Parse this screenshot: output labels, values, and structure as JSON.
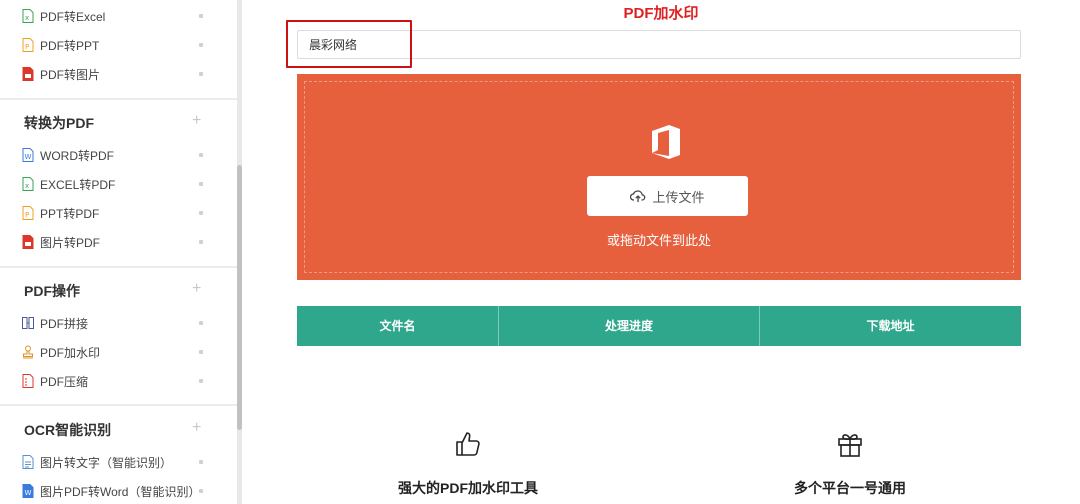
{
  "sidebar": {
    "groups": [
      {
        "title": "",
        "items": [
          {
            "label": "PDF转Excel",
            "icon": "excel-file-icon"
          },
          {
            "label": "PDF转PPT",
            "icon": "ppt-file-icon"
          },
          {
            "label": "PDF转图片",
            "icon": "image-file-icon"
          }
        ]
      },
      {
        "title": "转换为PDF",
        "items": [
          {
            "label": "WORD转PDF",
            "icon": "word-file-icon"
          },
          {
            "label": "EXCEL转PDF",
            "icon": "excel-file-icon"
          },
          {
            "label": "PPT转PDF",
            "icon": "ppt-file-icon"
          },
          {
            "label": "图片转PDF",
            "icon": "image-file-icon"
          }
        ]
      },
      {
        "title": "PDF操作",
        "items": [
          {
            "label": "PDF拼接",
            "icon": "merge-icon"
          },
          {
            "label": "PDF加水印",
            "icon": "stamp-icon"
          },
          {
            "label": "PDF压缩",
            "icon": "compress-file-icon"
          }
        ]
      },
      {
        "title": "OCR智能识别",
        "items": [
          {
            "label": "图片转文字（智能识别）",
            "icon": "image-text-icon"
          },
          {
            "label": "图片PDF转Word（智能识别）",
            "icon": "word-file-icon"
          }
        ]
      }
    ],
    "expand_symbol": "+"
  },
  "main": {
    "title": "PDF加水印",
    "watermark_input": {
      "value": "晨彩网络",
      "placeholder": ""
    },
    "upload": {
      "icon": "office-icon",
      "button_label": "上传文件",
      "button_icon": "cloud-upload-icon",
      "drag_hint": "或拖动文件到此处",
      "bg_color": "#e7603d"
    },
    "table": {
      "headers": [
        "文件名",
        "处理进度",
        "下载地址"
      ],
      "header_color": "#2fa78d"
    },
    "features": [
      {
        "icon": "thumbs-up-icon",
        "label": "强大的PDF加水印工具"
      },
      {
        "icon": "gift-icon",
        "label": "多个平台一号通用"
      }
    ]
  },
  "colors": {
    "title_red": "#e02020",
    "highlight_border": "#cc1111"
  }
}
